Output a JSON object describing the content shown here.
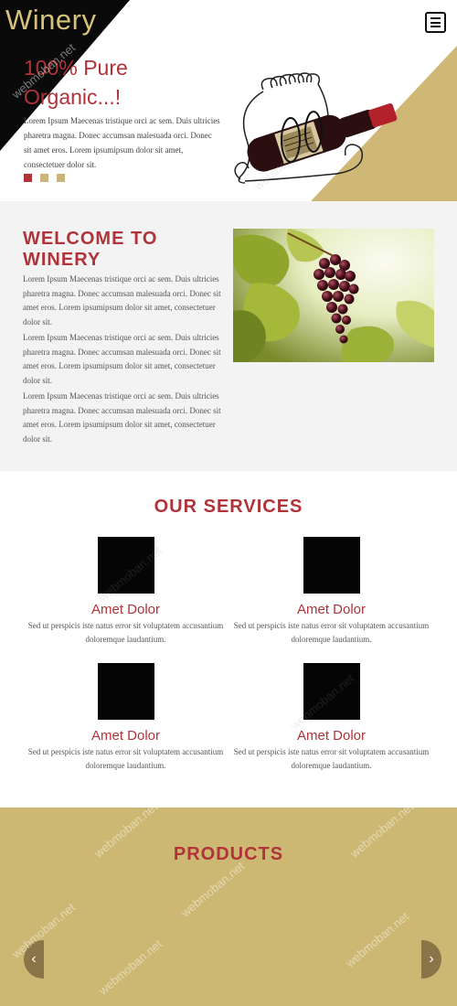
{
  "header": {
    "logo": "Winery",
    "menu_icon": "hamburger-menu-icon"
  },
  "hero": {
    "title": "100% Pure Organic...!",
    "text": "Lorem Ipsum Maecenas tristique orci ac sem. Duis ultricies pharetra magna. Donec accumsan malesuada orci. Donec sit amet eros. Lorem ipsumipsum dolor sit amet, consectetuer dolor sit.",
    "slide_count": 3,
    "active_slide": 1
  },
  "welcome": {
    "title": "WELCOME TO WINERY",
    "paragraphs": [
      "Lorem Ipsum Maecenas tristique orci ac sem. Duis ultricies pharetra magna. Donec accumsan malesuada orci. Donec sit amet eros. Lorem ipsumipsum dolor sit amet, consectetuer dolor sit.",
      "Lorem Ipsum Maecenas tristique orci ac sem. Duis ultricies pharetra magna. Donec accumsan malesuada orci. Donec sit amet eros. Lorem ipsumipsum dolor sit amet, consectetuer dolor sit.",
      "Lorem Ipsum Maecenas tristique orci ac sem. Duis ultricies pharetra magna. Donec accumsan malesuada orci. Donec sit amet eros. Lorem ipsumipsum dolor sit amet, consectetuer dolor sit."
    ]
  },
  "services": {
    "title": "OUR SERVICES",
    "items": [
      {
        "title": "Amet Dolor",
        "text": "Sed ut perspicis iste natus error sit voluptatem accusantium doloremque laudantium."
      },
      {
        "title": "Amet Dolor",
        "text": "Sed ut perspicis iste natus error sit voluptatem accusantium doloremque laudantium."
      },
      {
        "title": "Amet Dolor",
        "text": "Sed ut perspicis iste natus error sit voluptatem accusantium doloremque laudantium."
      },
      {
        "title": "Amet Dolor",
        "text": "Sed ut perspicis iste natus error sit voluptatem accusantium doloremque laudantium."
      }
    ]
  },
  "products": {
    "title": "PRODUCTS",
    "prev_icon": "chevron-left-icon",
    "next_icon": "chevron-right-icon",
    "prev_glyph": "‹",
    "next_glyph": "›"
  },
  "watermark": "webmoban.net",
  "colors": {
    "accent": "#b0333a",
    "gold": "#cdb873",
    "black": "#0a0a0a",
    "light_bg": "#f3f3f3"
  }
}
